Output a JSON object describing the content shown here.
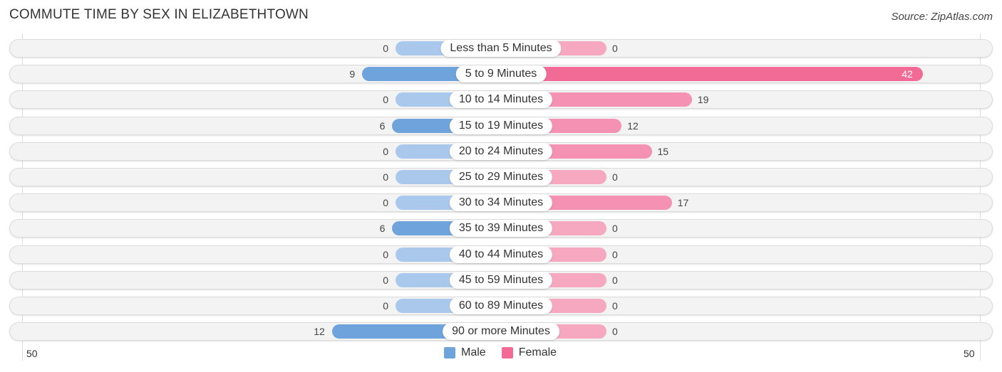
{
  "header": {
    "title": "COMMUTE TIME BY SEX IN ELIZABETHTOWN",
    "source": "Source: ZipAtlas.com"
  },
  "colors": {
    "male": "#6fa3dc",
    "male_light": "#a9c8ec",
    "female": "#f26b96",
    "female_light": "#f7a8c1"
  },
  "chart_data": {
    "type": "bar",
    "orientation": "horizontal-diverging",
    "title": "COMMUTE TIME BY SEX IN ELIZABETHTOWN",
    "categories": [
      "Less than 5 Minutes",
      "5 to 9 Minutes",
      "10 to 14 Minutes",
      "15 to 19 Minutes",
      "20 to 24 Minutes",
      "25 to 29 Minutes",
      "30 to 34 Minutes",
      "35 to 39 Minutes",
      "40 to 44 Minutes",
      "45 to 59 Minutes",
      "60 to 89 Minutes",
      "90 or more Minutes"
    ],
    "series": [
      {
        "name": "Male",
        "values": [
          0,
          9,
          0,
          6,
          0,
          0,
          0,
          6,
          0,
          0,
          0,
          12
        ]
      },
      {
        "name": "Female",
        "values": [
          0,
          42,
          19,
          12,
          15,
          0,
          17,
          0,
          0,
          0,
          0,
          0
        ]
      }
    ],
    "xlim": [
      50,
      50
    ],
    "axis_labels": {
      "left": "50",
      "right": "50"
    },
    "legend": {
      "position": "bottom-center",
      "entries": [
        "Male",
        "Female"
      ]
    }
  }
}
